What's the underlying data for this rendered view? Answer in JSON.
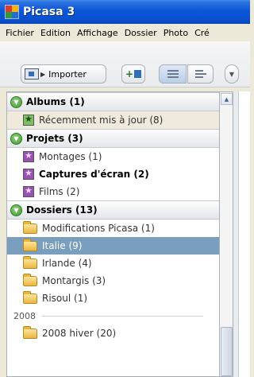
{
  "window": {
    "title": "Picasa 3"
  },
  "menu": [
    "Fichier",
    "Edition",
    "Affichage",
    "Dossier",
    "Photo",
    "Cré"
  ],
  "toolbar": {
    "import_label": "Importer"
  },
  "sections": {
    "albums": {
      "header": "Albums (1)",
      "items": [
        "Récemment mis à jour (8)"
      ]
    },
    "projets": {
      "header": "Projets (3)",
      "items": [
        "Montages (1)",
        "Captures d'écran (2)",
        "Films (2)"
      ]
    },
    "dossiers": {
      "header": "Dossiers (13)",
      "items": [
        "Modifications Picasa (1)",
        "Italie (9)",
        "Irlande (4)",
        "Montargis (3)",
        "Risoul (1)"
      ],
      "year": "2008",
      "year_items": [
        "2008 hiver (20)"
      ]
    }
  },
  "colors": {
    "selected_bg": "#7a9fbe",
    "title_bar": "#0a56d8",
    "expander_green": "#3e9a2c"
  }
}
